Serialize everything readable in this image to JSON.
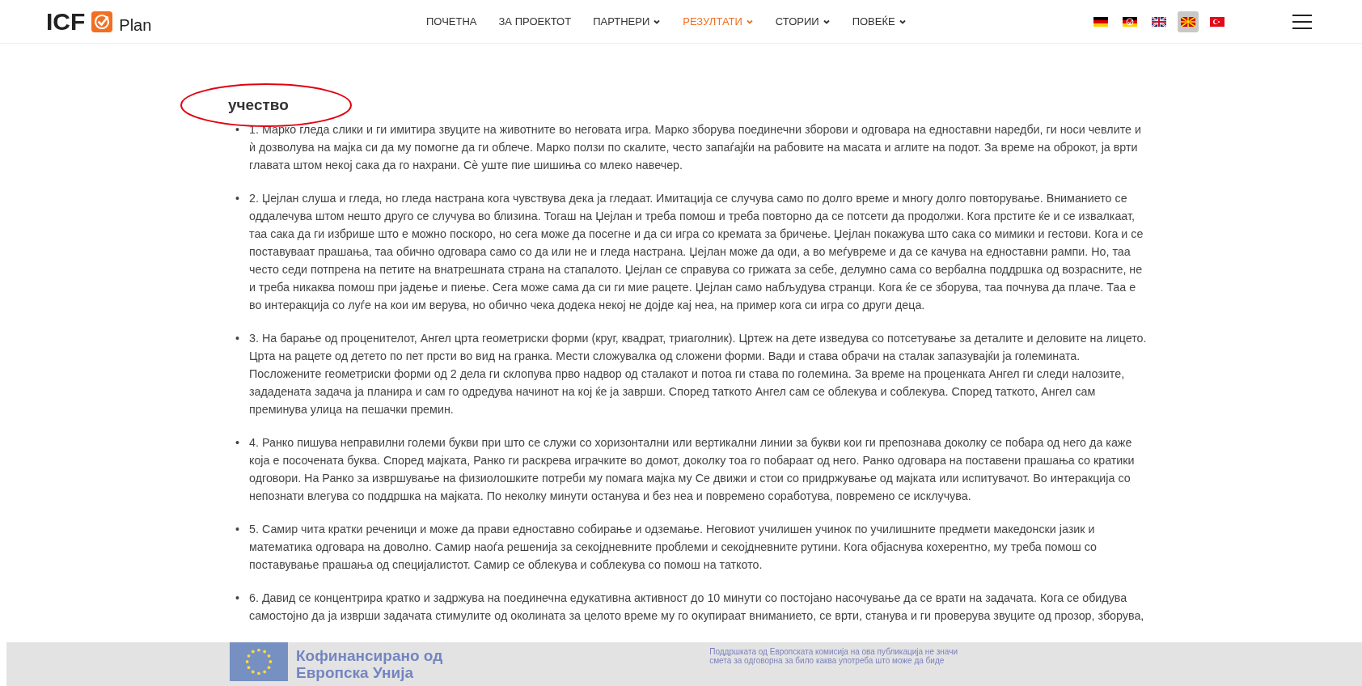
{
  "header": {
    "logo": {
      "left": "ICF",
      "right": "Plan"
    },
    "nav": [
      {
        "label": "ПОЧЕТНА",
        "dropdown": false,
        "selected": false
      },
      {
        "label": "ЗА ПРОЕКТОТ",
        "dropdown": false,
        "selected": false
      },
      {
        "label": "ПАРТНЕРИ",
        "dropdown": true,
        "selected": false
      },
      {
        "label": "РЕЗУЛТАТИ",
        "dropdown": true,
        "selected": true
      },
      {
        "label": "СТОРИИ",
        "dropdown": true,
        "selected": false
      },
      {
        "label": "ПОВЕЌЕ",
        "dropdown": true,
        "selected": false
      }
    ],
    "languages": [
      {
        "kind": "de",
        "selected": false
      },
      {
        "kind": "de-plan",
        "selected": false
      },
      {
        "kind": "gb",
        "selected": false
      },
      {
        "kind": "mk",
        "selected": true
      },
      {
        "kind": "tr",
        "selected": false
      }
    ]
  },
  "heading": "учество",
  "items": [
    {
      "marker": "•",
      "text": "1. Марко гледа слики и ги имитира звуците на животните во неговата игра. Марко зборува поединечни зборови и одговара на едноставни наредби, ги носи чевлите и ѝ дозволува на мајка си да му помогне да ги облече. Марко ползи по скалите, често запаѓајќи на рабовите на масата и аглите на подот. За време на оброкот, ја врти главата штом некој сака да го нахрани. Сѐ уште пие шишиња со млеко навечер."
    },
    {
      "marker": "•",
      "text": "2. Џејлан слуша и гледа, но гледа настрана кога чувствува дека ја гледаат. Имитација се случува само по долго време и многу долго повторување. Вниманието се оддалечува штом нешто друго се случува во близина. Тогаш на Џејлан и треба помош и треба повторно да се потсети да продолжи. Кога прстите ќе и се извалкаат, таа сака да ги избрише што е можно поскоро, но сега може да посегне и да си игра со кремата за бричење. Џејлан покажува што сака со мимики и гестови. Кога и се поставуваат прашања, таа обично одговара само со да или не и гледа настрана. Џејлан може да оди, а во меѓувреме и да се качува на едноставни рампи. Но, таа често седи потпрена на петите на внатрешната страна на стапалото. Џејлан се справува со грижата за себе, делумно сама со вербална поддршка од возрасните, не и треба никаква помош при јадење и пиење. Сега може сама да си ги мие рацете. Џејлан само набљудува странци. Кога ќе се зборува, таа почнува да плаче. Таа е во интеракција со луѓе на кои им верува, но обично чека додека некој не дојде кај неа, на пример кога си игра со други деца."
    },
    {
      "marker": "•",
      "text": "3. На барање од проценителот, Ангел црта геометриски форми (круг, квадрат, триаголник). Цртеж на дете изведува со потсетување за деталите и деловите на лицето. Црта на рацете од детето по пет прсти во вид на гранка. Мести сложувалка од сложени форми. Вади и става обрачи на сталак запазувајќи ја големината. Посложените геометриски форми од 2 дела ги склопува прво надвор од сталакот и потоа ги става по големина. За време на проценката Ангел ги следи налозите, зададената задача ја планира и сам го одредува начинот на кој ќе ја заврши. Според таткото Ангел сам се облекува и соблекува. Според таткото, Ангел сам преминува улица на пешачки премин."
    },
    {
      "marker": "•",
      "text": "4. Ранко пишува неправилни големи букви при што се служи со хоризонтални или вертикални линии за букви кои ги препознава доколку се побара од него да каже која е посочената буква. Според мајката, Ранко ги раскрева играчките во домот, доколку тоа го побараат од него. Ранко одговара на поставени прашања со кратики одговори. На Ранко за извршување на физиолошките потреби му помага мајка му Се движи и стои со придржување од мајката или испитувачот. Во интеракција со непознати влегува со поддршка на мајката. По неколку минути останува и без неа и повремено соработува, повремено се исклучува."
    },
    {
      "marker": "•",
      "text": "5. Самир чита кратки реченици и може да прави едноставно собирање и одземање. Неговиот училишен учинок по училишните предмети македонски јазик и математика одговара на доволно. Самир наоѓа решенија за секојдневните проблеми и секојдневните рутини. Кога објаснува кохерентно, му треба помош со поставување прашања од специјалистот. Самир се облекува и соблекува со помош на таткото."
    },
    {
      "marker": "•",
      "text": "6. Давид се концентрира кратко и задржува на поединечна едукативна активност до 10 минути со постојано насочување да се врати на задачата. Кога се обидува самостојно да ја изврши задачата стимулите од околината за целото време му го окупираат вниманието, се врти, станува и ги проверува звуците од прозор, зборува,"
    }
  ],
  "footer": {
    "funding_title": [
      "Кофинансирано од",
      "Европска Унија"
    ],
    "disclaimer": [
      "Поддршката од Европската комисија на ова публикација не значи",
      "смета за одговорна за било каква употреба што може да биде"
    ]
  }
}
